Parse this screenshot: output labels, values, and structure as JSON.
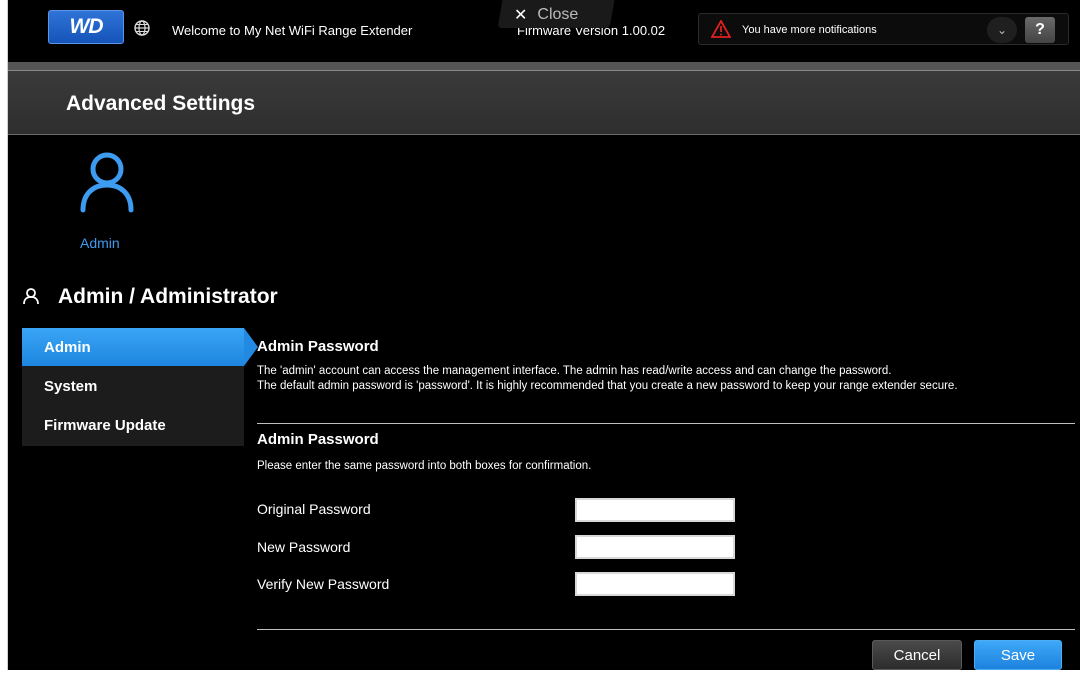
{
  "topbar": {
    "logo": "WD",
    "welcome": "Welcome to My Net WiFi Range Extender",
    "firmware": "Firmware Version 1.00.02",
    "notification": "You have more notifications",
    "help_label": "?"
  },
  "header": {
    "title": "Advanced Settings",
    "close_label": "Close"
  },
  "category": {
    "label": "Admin"
  },
  "section": {
    "title": "Admin / Administrator"
  },
  "sidenav": {
    "items": [
      {
        "label": "Admin"
      },
      {
        "label": "System"
      },
      {
        "label": "Firmware Update"
      }
    ]
  },
  "content": {
    "intro_heading": "Admin Password",
    "intro_line1": "The 'admin' account can access the management interface. The admin has read/write access and can change the password.",
    "intro_line2": "The default admin password is 'password'. It is highly recommended that you create a new password to keep your range extender secure.",
    "form_heading": "Admin Password",
    "form_desc": "Please enter the same password into both boxes for confirmation.",
    "fields": [
      {
        "label": "Original Password",
        "value": ""
      },
      {
        "label": "New Password",
        "value": ""
      },
      {
        "label": "Verify New Password",
        "value": ""
      }
    ],
    "cancel_label": "Cancel",
    "save_label": "Save"
  },
  "colors": {
    "accent": "#1d86e0",
    "background": "#000000",
    "warning": "#e02020"
  }
}
